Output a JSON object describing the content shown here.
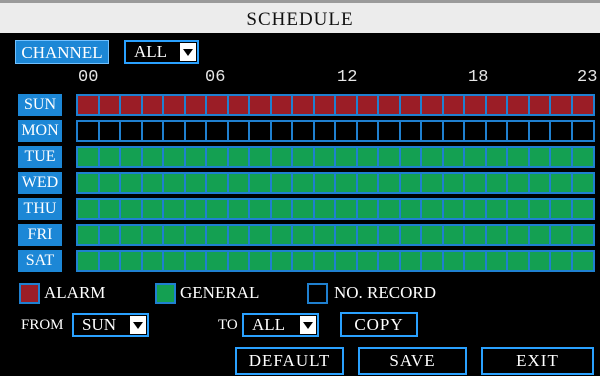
{
  "title": "SCHEDULE",
  "channel": {
    "label": "CHANNEL",
    "value": "ALL"
  },
  "hours": [
    "00",
    "06",
    "12",
    "18",
    "23"
  ],
  "days": [
    {
      "label": "SUN",
      "mode": "alarm"
    },
    {
      "label": "MON",
      "mode": "none"
    },
    {
      "label": "TUE",
      "mode": "general"
    },
    {
      "label": "WED",
      "mode": "general"
    },
    {
      "label": "THU",
      "mode": "general"
    },
    {
      "label": "FRI",
      "mode": "general"
    },
    {
      "label": "SAT",
      "mode": "general"
    }
  ],
  "slots_per_day": 24,
  "colors": {
    "alarm": "#9b1d26",
    "general": "#14a052",
    "none": "#000000",
    "accent": "#1c87d6",
    "border": "#1f80d0"
  },
  "legend": {
    "alarm": "ALARM",
    "general": "GENERAL",
    "no_record": "NO. RECORD"
  },
  "copy_row": {
    "from_label": "FROM",
    "from_value": "SUN",
    "to_label": "TO",
    "to_value": "ALL",
    "copy_button": "COPY"
  },
  "buttons": {
    "default": "DEFAULT",
    "save": "SAVE",
    "exit": "EXIT"
  }
}
